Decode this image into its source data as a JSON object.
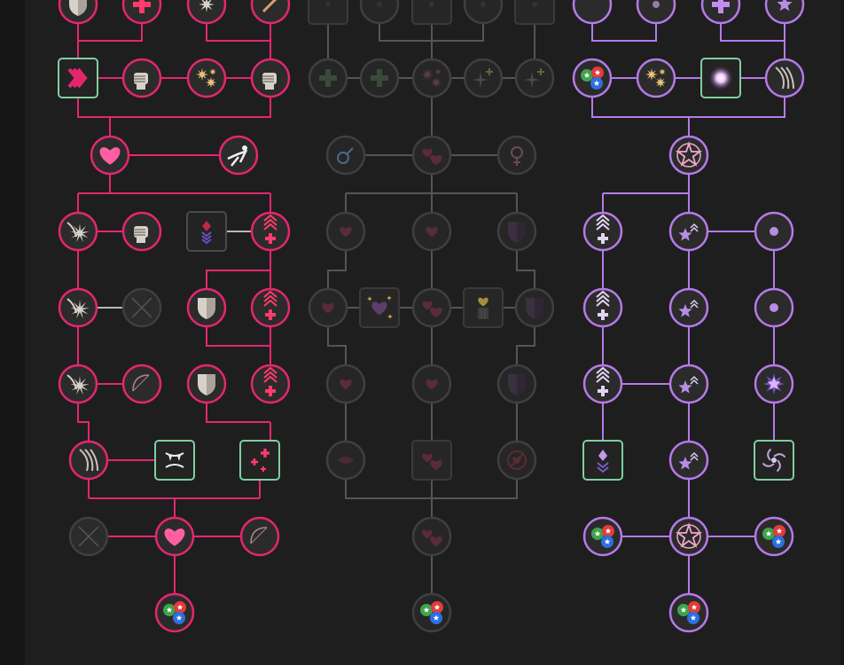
{
  "window": {
    "title": ""
  },
  "colors": {
    "pink": "#e5266e",
    "purple": "#b57ae8",
    "gray": "#555555",
    "learned_square": "#7fcfa0",
    "node_fill": "#2b2b2b",
    "heart": "#ff5fa2",
    "locked_icon": "#3a3a3a",
    "gold": "#d9b948"
  },
  "trees": [
    {
      "name": "left",
      "status": "learned",
      "nodes": [
        {
          "id": "l-top-1",
          "icon": "shield-icon",
          "shape": "circle"
        },
        {
          "id": "l-top-2",
          "icon": "plus-icon",
          "shape": "circle"
        },
        {
          "id": "l-top-3",
          "icon": "sparkle-icon",
          "shape": "circle"
        },
        {
          "id": "l-top-4",
          "icon": "sword-icon",
          "shape": "circle"
        },
        {
          "id": "l-r1-1",
          "icon": "chevrons-icon",
          "shape": "square"
        },
        {
          "id": "l-r1-2",
          "icon": "fist-icon",
          "shape": "circle"
        },
        {
          "id": "l-r1-3",
          "icon": "burst-icon",
          "shape": "circle"
        },
        {
          "id": "l-r1-4",
          "icon": "fist-icon",
          "shape": "circle"
        },
        {
          "id": "l-heart",
          "icon": "heart-icon",
          "shape": "circle"
        },
        {
          "id": "l-acrobat",
          "icon": "acrobat-icon",
          "shape": "circle"
        },
        {
          "id": "l-r3-1",
          "icon": "claw-burst-icon",
          "shape": "circle"
        },
        {
          "id": "l-r3-2",
          "icon": "fist-icon",
          "shape": "circle"
        },
        {
          "id": "l-r3-3",
          "icon": "arrow-gem-icon",
          "shape": "square"
        },
        {
          "id": "l-r3-4",
          "icon": "rank-up-icon",
          "shape": "circle"
        },
        {
          "id": "l-r4-1",
          "icon": "claw-burst-icon",
          "shape": "circle"
        },
        {
          "id": "l-r4-2",
          "icon": "crossed-swords-icon",
          "shape": "circle"
        },
        {
          "id": "l-r4-3",
          "icon": "shield-icon",
          "shape": "circle"
        },
        {
          "id": "l-r4-4",
          "icon": "rank-up-icon",
          "shape": "circle"
        },
        {
          "id": "l-r5-1",
          "icon": "claw-burst-icon",
          "shape": "circle"
        },
        {
          "id": "l-r5-2",
          "icon": "bow-icon",
          "shape": "circle"
        },
        {
          "id": "l-r5-3",
          "icon": "shield-icon",
          "shape": "circle"
        },
        {
          "id": "l-r5-4",
          "icon": "rank-up-icon",
          "shape": "circle"
        },
        {
          "id": "l-r6-1",
          "icon": "claws-icon",
          "shape": "circle"
        },
        {
          "id": "l-r6-2",
          "icon": "fangs-icon",
          "shape": "square"
        },
        {
          "id": "l-r6-3",
          "icon": "plus-cluster-icon",
          "shape": "square"
        },
        {
          "id": "l-r7-1",
          "icon": "crossed-swords-icon",
          "shape": "circle"
        },
        {
          "id": "l-r7-2",
          "icon": "heart-icon",
          "shape": "circle"
        },
        {
          "id": "l-r7-3",
          "icon": "bow-icon",
          "shape": "circle"
        },
        {
          "id": "l-final",
          "icon": "element-orbs-icon",
          "shape": "circle"
        }
      ]
    },
    {
      "name": "center",
      "status": "locked",
      "nodes": [
        {
          "id": "c-top-1",
          "icon": "locked-icon",
          "shape": "square"
        },
        {
          "id": "c-top-2",
          "icon": "locked-icon",
          "shape": "circle"
        },
        {
          "id": "c-top-3",
          "icon": "locked-icon",
          "shape": "square"
        },
        {
          "id": "c-top-4",
          "icon": "locked-icon",
          "shape": "circle"
        },
        {
          "id": "c-top-5",
          "icon": "locked-icon",
          "shape": "square"
        },
        {
          "id": "c-r1-1",
          "icon": "plus-icon",
          "shape": "circle"
        },
        {
          "id": "c-r1-2",
          "icon": "plus-icon",
          "shape": "circle"
        },
        {
          "id": "c-r1-3",
          "icon": "burst-icon",
          "shape": "circle"
        },
        {
          "id": "c-r1-4",
          "icon": "spark-plus-icon",
          "shape": "circle"
        },
        {
          "id": "c-r1-5",
          "icon": "spark-plus-icon",
          "shape": "circle"
        },
        {
          "id": "c-male",
          "icon": "male-icon",
          "shape": "circle"
        },
        {
          "id": "c-hearts",
          "icon": "hearts-icon",
          "shape": "circle"
        },
        {
          "id": "c-female",
          "icon": "female-icon",
          "shape": "circle"
        },
        {
          "id": "c-r3-1",
          "icon": "heart-icon",
          "shape": "circle"
        },
        {
          "id": "c-r3-2",
          "icon": "heart-icon",
          "shape": "circle"
        },
        {
          "id": "c-r3-3",
          "icon": "shield-icon",
          "shape": "circle"
        },
        {
          "id": "c-r4-1",
          "icon": "heart-icon",
          "shape": "circle"
        },
        {
          "id": "c-r4-2",
          "icon": "sparkle-heart-icon",
          "shape": "square"
        },
        {
          "id": "c-r4-3",
          "icon": "hearts-icon",
          "shape": "circle"
        },
        {
          "id": "c-r4-4",
          "icon": "heart-pillar-icon",
          "shape": "square"
        },
        {
          "id": "c-r4-5",
          "icon": "shield-icon",
          "shape": "circle"
        },
        {
          "id": "c-r5-1",
          "icon": "heart-icon",
          "shape": "circle"
        },
        {
          "id": "c-r5-2",
          "icon": "heart-icon",
          "shape": "circle"
        },
        {
          "id": "c-r5-3",
          "icon": "shield-icon",
          "shape": "circle"
        },
        {
          "id": "c-r6-1",
          "icon": "kiss-icon",
          "shape": "circle"
        },
        {
          "id": "c-r6-2",
          "icon": "hearts-icon",
          "shape": "square"
        },
        {
          "id": "c-r6-3",
          "icon": "no-heart-icon",
          "shape": "circle"
        },
        {
          "id": "c-r7",
          "icon": "hearts-icon",
          "shape": "circle"
        },
        {
          "id": "c-final",
          "icon": "element-orbs-icon",
          "shape": "circle"
        }
      ]
    },
    {
      "name": "right",
      "status": "learned",
      "nodes": [
        {
          "id": "r-top-1",
          "icon": "moon-icon",
          "shape": "circle"
        },
        {
          "id": "r-top-2",
          "icon": "orb-icon",
          "shape": "circle"
        },
        {
          "id": "r-top-3",
          "icon": "plus-icon",
          "shape": "circle"
        },
        {
          "id": "r-top-4",
          "icon": "star-icon",
          "shape": "circle"
        },
        {
          "id": "r-r1-1",
          "icon": "element-orbs-icon",
          "shape": "circle"
        },
        {
          "id": "r-r1-2",
          "icon": "burst-icon",
          "shape": "circle"
        },
        {
          "id": "r-r1-3",
          "icon": "flash-icon",
          "shape": "square"
        },
        {
          "id": "r-r1-4",
          "icon": "claws-icon",
          "shape": "circle"
        },
        {
          "id": "r-pentagram",
          "icon": "pentagram-icon",
          "shape": "circle"
        },
        {
          "id": "r-r3-1",
          "icon": "rank-up-icon",
          "shape": "circle"
        },
        {
          "id": "r-r3-2",
          "icon": "star-up-icon",
          "shape": "circle"
        },
        {
          "id": "r-r3-3",
          "icon": "dot-icon",
          "shape": "circle"
        },
        {
          "id": "r-r4-1",
          "icon": "rank-up-icon",
          "shape": "circle"
        },
        {
          "id": "r-r4-2",
          "icon": "star-up-icon",
          "shape": "circle"
        },
        {
          "id": "r-r4-3",
          "icon": "dot-icon",
          "shape": "circle"
        },
        {
          "id": "r-r5-1",
          "icon": "rank-up-icon",
          "shape": "circle"
        },
        {
          "id": "r-r5-2",
          "icon": "star-up-icon",
          "shape": "circle"
        },
        {
          "id": "r-r5-3",
          "icon": "star-burst-icon",
          "shape": "circle"
        },
        {
          "id": "r-r6-1",
          "icon": "gem-down-icon",
          "shape": "square"
        },
        {
          "id": "r-r6-2",
          "icon": "star-up-icon",
          "shape": "circle"
        },
        {
          "id": "r-r6-3",
          "icon": "vortex-icon",
          "shape": "square"
        },
        {
          "id": "r-r7-1",
          "icon": "element-orbs-icon",
          "shape": "circle"
        },
        {
          "id": "r-r7-2",
          "icon": "pentagram-icon",
          "shape": "circle"
        },
        {
          "id": "r-r7-3",
          "icon": "element-orbs-icon",
          "shape": "circle"
        },
        {
          "id": "r-final",
          "icon": "element-orbs-icon",
          "shape": "circle"
        }
      ]
    }
  ]
}
